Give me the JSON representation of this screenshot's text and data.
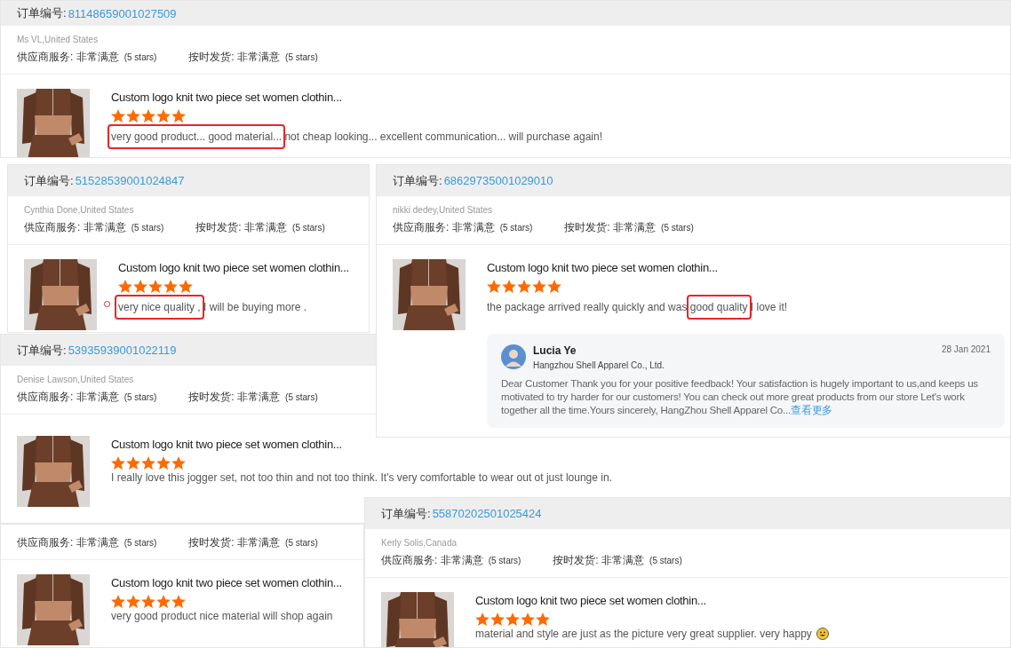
{
  "reviews": [
    {
      "order_label": "订单编号:",
      "order_no": "81148659001027509",
      "customer": "Ms VL,United States",
      "ratings": [
        {
          "label": "供应商服务:",
          "value": "非常满意",
          "note": "(5 stars)"
        },
        {
          "label": "按时发货:",
          "value": "非常满意",
          "note": "(5 stars)"
        }
      ],
      "product_title": "Custom logo knit two piece set women clothin...",
      "stars": 5,
      "comment": [
        {
          "kind": "highlighted",
          "text": "very good product... good material..."
        },
        {
          "kind": "plain",
          "text": " not cheap looking... excellent communication... will purchase again!"
        }
      ]
    },
    {
      "order_label": "订单编号:",
      "order_no": "51528539001024847",
      "customer": "Cynthia Done,United States",
      "ratings": [
        {
          "label": "供应商服务:",
          "value": "非常满意",
          "note": "(5 stars)"
        },
        {
          "label": "按时发货:",
          "value": "非常满意",
          "note": "(5 stars)"
        }
      ],
      "product_title": "Custom logo knit two piece set women clothin...",
      "stars": 5,
      "marker": true,
      "comment": [
        {
          "kind": "highlighted",
          "text": "very nice quality ,"
        },
        {
          "kind": "plain",
          "text": " I will be buying more ."
        }
      ]
    },
    {
      "order_label": "订单编号:",
      "order_no": "68629735001029010",
      "customer": "nikki dedey,United States",
      "ratings": [
        {
          "label": "供应商服务:",
          "value": "非常满意",
          "note": "(5 stars)"
        },
        {
          "label": "按时发货:",
          "value": "非常满意",
          "note": "(5 stars)"
        }
      ],
      "product_title": "Custom logo knit two piece set women clothin...",
      "stars": 5,
      "comment": [
        {
          "kind": "plain",
          "text": "the package arrived really quickly and was "
        },
        {
          "kind": "highlighted",
          "text": "good quality"
        },
        {
          "kind": "plain",
          "text": " I love it!"
        }
      ],
      "reply": {
        "name": "Lucia Ye",
        "company": "Hangzhou Shell Apparel Co., Ltd.",
        "date": "28 Jan 2021",
        "text": "Dear Customer Thank you for your positive feedback! Your satisfaction is hugely important to us,and keeps us motivated to try harder for our customers! You can check out more great products from our store Let's work together all the time.Yours sincerely, HangZhou Shell Apparel Co...",
        "more": "查看更多"
      }
    },
    {
      "order_label": "订单编号:",
      "order_no": "53935939001022119",
      "customer": "Denise Lawson,United States",
      "ratings": [
        {
          "label": "供应商服务:",
          "value": "非常满意",
          "note": "(5 stars)"
        },
        {
          "label": "按时发货:",
          "value": "非常满意",
          "note": "(5 stars)"
        }
      ],
      "product_title": "Custom logo knit two piece set women clothin...",
      "stars": 5,
      "comment": [
        {
          "kind": "plain",
          "text": "I really love this jogger set, not too thin and not too think. It's very comfortable to wear out ot just lounge in."
        }
      ]
    },
    {
      "ratings": [
        {
          "label": "供应商服务:",
          "value": "非常满意",
          "note": "(5 stars)"
        },
        {
          "label": "按时发货:",
          "value": "非常满意",
          "note": "(5 stars)"
        }
      ],
      "product_title": "Custom logo knit two piece set women clothin...",
      "stars": 5,
      "comment": [
        {
          "kind": "plain",
          "text": "very good product nice material will shop again"
        }
      ]
    },
    {
      "order_label": "订单编号:",
      "order_no": "55870202501025424",
      "customer": "Kerly Solis,Canada",
      "ratings": [
        {
          "label": "供应商服务:",
          "value": "非常满意",
          "note": "(5 stars)"
        },
        {
          "label": "按时发货:",
          "value": "非常满意",
          "note": "(5 stars)"
        }
      ],
      "product_title": "Custom logo knit two piece set women clothin...",
      "stars": 5,
      "comment": [
        {
          "kind": "plain",
          "text": "material and style are just as the picture very great supplier. very happy "
        },
        {
          "kind": "smiley"
        }
      ]
    }
  ]
}
